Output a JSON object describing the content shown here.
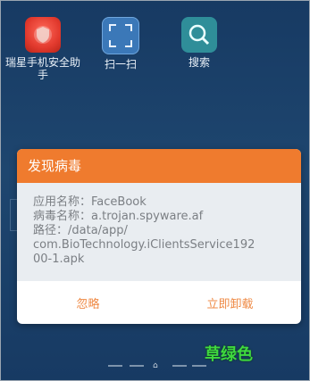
{
  "apps": [
    {
      "label": "瑞星手机安全助手",
      "icon": "shield-icon"
    },
    {
      "label": "扫一扫",
      "icon": "scan-icon"
    },
    {
      "label": "搜索",
      "icon": "search-icon"
    }
  ],
  "dialog": {
    "title": "发现病毒",
    "app_name_line": "应用名称：FaceBook",
    "virus_name_line": "病毒名称：a.trojan.spyware.af",
    "path_label": "路径：/data/app/",
    "path_value": "com.BioTechnology.iClientsService192",
    "path_value_cont": "00-1.apk",
    "ignore_label": "忽略",
    "uninstall_label": "立即卸载"
  },
  "watermark": "草绿色",
  "colors": {
    "accent": "#ef7b2e",
    "button_text": "#ef8a45",
    "watermark": "#3fd93f"
  }
}
